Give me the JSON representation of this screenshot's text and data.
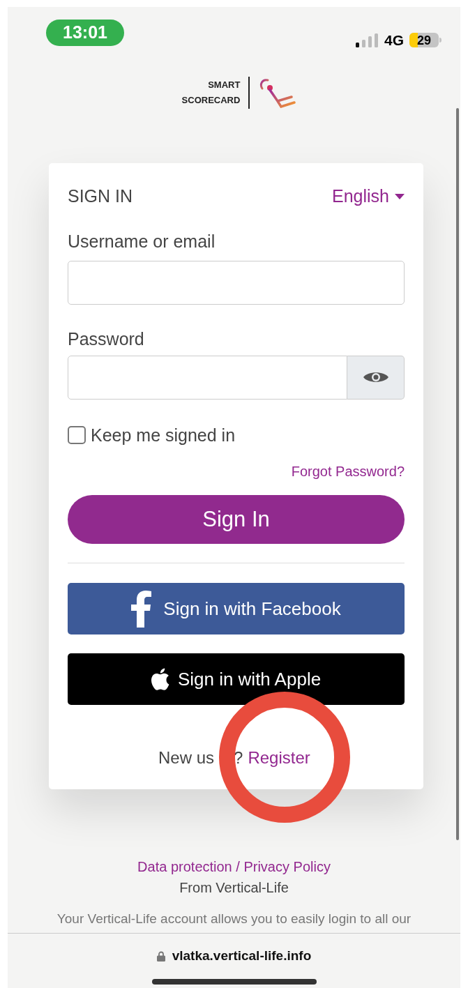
{
  "status_bar": {
    "time": "13:01",
    "network": "4G",
    "battery": "29"
  },
  "logo": {
    "line_1": "SMART",
    "line_2": "SCORECARD"
  },
  "card": {
    "title": "SIGN IN",
    "language": "English",
    "fields": [
      {
        "label": "Username or email",
        "kind": "text"
      },
      {
        "label": "Password",
        "kind": "password"
      }
    ],
    "keep_signed_in": {
      "label": "Keep me signed in",
      "checked": false
    },
    "forgot_link": "Forgot Password?",
    "sign_in_button": "Sign In",
    "social_buttons": [
      {
        "kind": "facebook",
        "label": "Sign in with Facebook"
      },
      {
        "kind": "apple",
        "label": "Sign in with Apple"
      }
    ],
    "register": {
      "prefix": "New us",
      "suffix": "?",
      "link": "Register"
    }
  },
  "footer": {
    "privacy_link": "Data protection / Privacy Policy",
    "from": "From Vertical-Life",
    "note": "Your Vertical-Life account allows you to easily login to all our"
  },
  "browser_bar": {
    "url": "vlatka.vertical-life.info"
  }
}
